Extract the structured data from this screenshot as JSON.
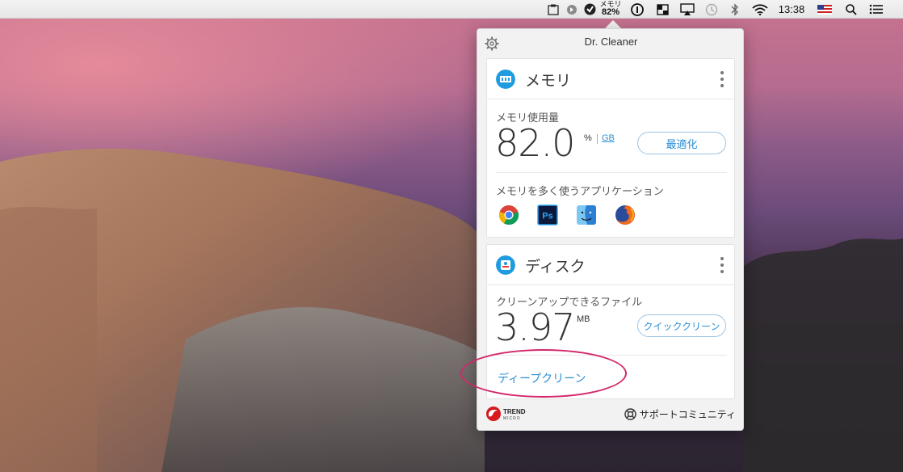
{
  "menubar": {
    "memory_label": "メモリ",
    "memory_pct": "82%",
    "clock": "13:38",
    "icons": [
      "clipboard-icon",
      "circle-arrow-icon",
      "dr-cleaner-icon",
      "info-icon",
      "window-icon",
      "airplay-icon",
      "time-machine-icon",
      "bluetooth-icon",
      "wifi-icon",
      "flag-us-icon",
      "spotlight-icon",
      "notification-list-icon"
    ]
  },
  "popover": {
    "title": "Dr. Cleaner",
    "memory_card": {
      "title": "メモリ",
      "usage_label": "メモリ使用量",
      "value": "82.0",
      "unit_pct": "%",
      "unit_gb": "GB",
      "button": "最適化",
      "apps_label": "メモリを多く使うアプリケーション",
      "apps": [
        "chrome-icon",
        "photoshop-icon",
        "finder-icon",
        "firefox-icon"
      ]
    },
    "disk_card": {
      "title": "ディスク",
      "files_label": "クリーンアップできるファイル",
      "value": "3.97",
      "unit": "MB",
      "button": "クイッククリーン",
      "deep_clean": "ディープクリーン"
    },
    "footer": {
      "brand_top": "TREND",
      "brand_bottom": "MICRO",
      "support": "サポートコミュニティ"
    }
  },
  "colors": {
    "accent": "#2b8fd6",
    "highlight_ring": "#d3286a",
    "trend_red": "#d71920"
  }
}
